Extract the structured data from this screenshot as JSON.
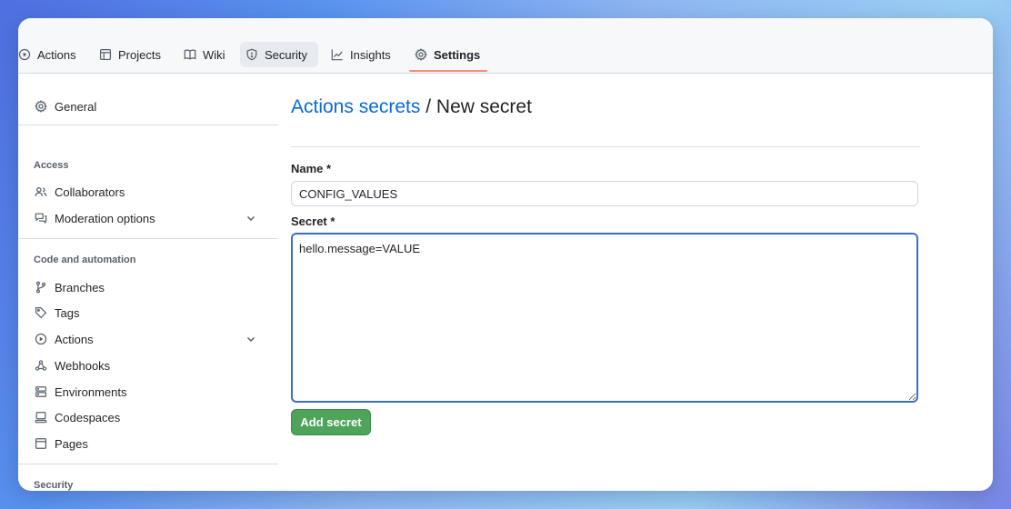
{
  "nav": {
    "tabs": [
      {
        "label": "Actions",
        "icon": "play-circle-icon"
      },
      {
        "label": "Projects",
        "icon": "table-icon"
      },
      {
        "label": "Wiki",
        "icon": "book-icon"
      },
      {
        "label": "Security",
        "icon": "shield-icon"
      },
      {
        "label": "Insights",
        "icon": "graph-icon"
      },
      {
        "label": "Settings",
        "icon": "gear-icon"
      }
    ],
    "active_tab": "Settings",
    "hover_tab": "Security",
    "underline_color": "#fd8c73"
  },
  "sidebar": {
    "general": "General",
    "sections": {
      "access": "Access",
      "code_automation": "Code and automation",
      "security": "Security"
    },
    "items": {
      "collaborators": "Collaborators",
      "moderation": "Moderation options",
      "branches": "Branches",
      "tags": "Tags",
      "actions": "Actions",
      "webhooks": "Webhooks",
      "environments": "Environments",
      "codespaces": "Codespaces",
      "pages": "Pages"
    }
  },
  "main": {
    "breadcrumb_link": "Actions secrets",
    "breadcrumb_sep": " / ",
    "breadcrumb_current": "New secret",
    "name_label": "Name *",
    "name_value": "CONFIG_VALUES",
    "secret_label": "Secret *",
    "secret_value": "hello.message=VALUE",
    "submit_label": "Add secret"
  },
  "colors": {
    "link": "#0969da",
    "primary_button": "#4ea45a",
    "focus_border": "#3a6fc9"
  }
}
